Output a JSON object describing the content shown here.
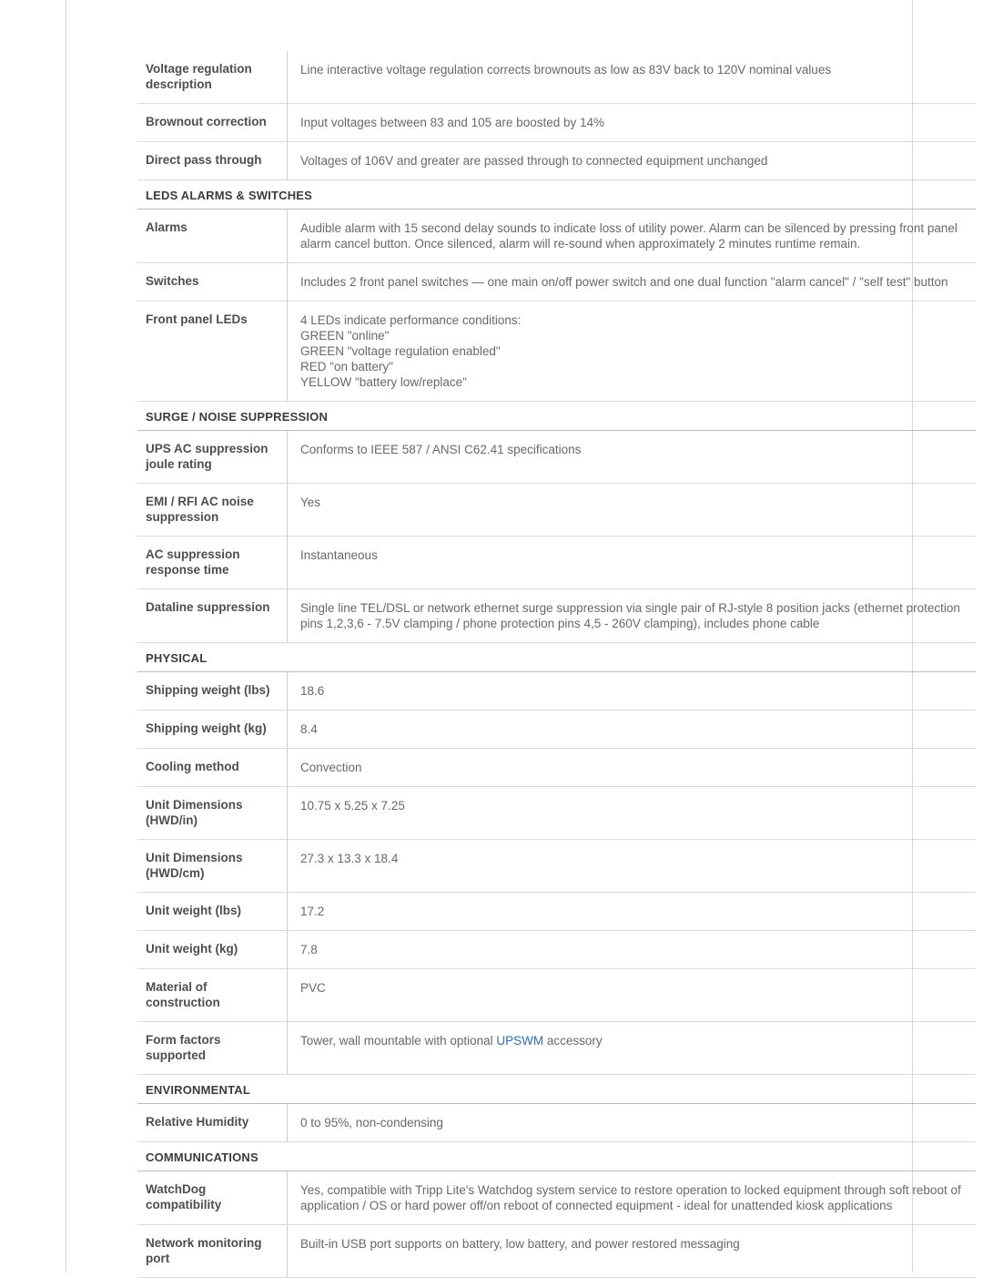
{
  "document": {
    "type": "product-specification-table",
    "link_color": "#2a6ebb",
    "label_color": "#4a4f52",
    "value_color": "#65696c"
  },
  "blocks": [
    {
      "kind": "row",
      "label": "Voltage regulation description",
      "value": "Line interactive voltage regulation corrects brownouts as low as 83V back to 120V nominal values"
    },
    {
      "kind": "row",
      "label": "Brownout correction",
      "value": "Input voltages between 83 and 105 are boosted by 14%"
    },
    {
      "kind": "row",
      "label": "Direct pass through",
      "value": "Voltages of 106V and greater are passed through to connected equipment unchanged"
    },
    {
      "kind": "section",
      "title": "LEDS ALARMS & SWITCHES"
    },
    {
      "kind": "row",
      "label": "Alarms",
      "value": "Audible alarm with 15 second delay sounds to indicate loss of utility power. Alarm can be silenced by pressing front panel alarm cancel button. Once silenced, alarm will re-sound when approximately 2 minutes runtime remain."
    },
    {
      "kind": "row",
      "label": "Switches",
      "value": "Includes 2 front panel switches — one main on/off power switch and one dual function \"alarm cancel\" / \"self test\" button"
    },
    {
      "kind": "row",
      "label": "Front panel LEDs",
      "value": "4 LEDs indicate performance conditions:\nGREEN \"online\"\nGREEN \"voltage regulation enabled\"\nRED \"on battery\"\nYELLOW \"battery low/replace\""
    },
    {
      "kind": "section",
      "title": "SURGE / NOISE SUPPRESSION"
    },
    {
      "kind": "row",
      "label": "UPS AC suppression joule rating",
      "value": "Conforms to IEEE 587 / ANSI C62.41 specifications"
    },
    {
      "kind": "row",
      "label": "EMI / RFI AC noise suppression",
      "value": "Yes"
    },
    {
      "kind": "row",
      "label": "AC suppression response time",
      "value": "Instantaneous"
    },
    {
      "kind": "row",
      "label": "Dataline suppression",
      "value": "Single line TEL/DSL or network ethernet surge suppression via single pair of RJ-style 8 position jacks (ethernet protection pins 1,2,3,6 - 7.5V clamping / phone protection pins 4,5 - 260V clamping), includes phone cable"
    },
    {
      "kind": "section",
      "title": "PHYSICAL"
    },
    {
      "kind": "row",
      "label": "Shipping weight (lbs)",
      "value": "18.6"
    },
    {
      "kind": "row",
      "label": "Shipping weight (kg)",
      "value": "8.4"
    },
    {
      "kind": "row",
      "label": "Cooling method",
      "value": "Convection"
    },
    {
      "kind": "row",
      "label": "Unit Dimensions (HWD/in)",
      "value": "10.75 x 5.25 x 7.25"
    },
    {
      "kind": "row",
      "label": "Unit Dimensions (HWD/cm)",
      "value": "27.3 x 13.3 x 18.4"
    },
    {
      "kind": "row",
      "label": "Unit weight (lbs)",
      "value": "17.2"
    },
    {
      "kind": "row",
      "label": "Unit weight (kg)",
      "value": "7.8"
    },
    {
      "kind": "row",
      "label": "Material of construction",
      "value": "PVC"
    },
    {
      "kind": "row",
      "label": "Form factors supported",
      "value_parts": [
        {
          "text": "Tower, wall mountable with optional "
        },
        {
          "text": "UPSWM",
          "link": true
        },
        {
          "text": " accessory"
        }
      ]
    },
    {
      "kind": "section",
      "title": "ENVIRONMENTAL"
    },
    {
      "kind": "row",
      "label": "Relative Humidity",
      "value": "0 to 95%, non-condensing"
    },
    {
      "kind": "section",
      "title": "COMMUNICATIONS"
    },
    {
      "kind": "row",
      "label": "WatchDog compatibility",
      "value": "Yes, compatible with Tripp Lite's Watchdog system service to restore operation to locked equipment through soft reboot of application / OS or hard power off/on reboot of connected equipment - ideal for unattended kiosk applications"
    },
    {
      "kind": "row",
      "label": "Network monitoring port",
      "value": "Built-in USB port supports on battery, low battery, and power restored messaging"
    }
  ]
}
